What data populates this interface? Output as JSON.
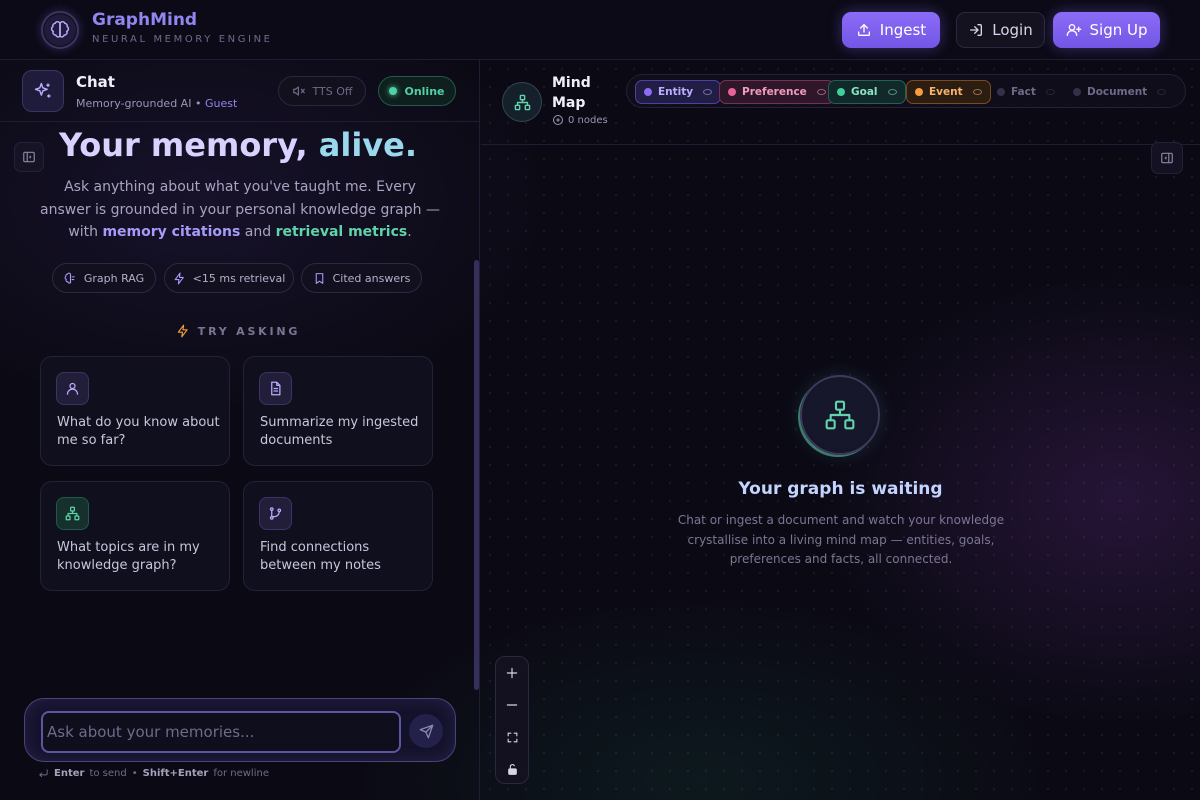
{
  "header": {
    "brand_name": "GraphMind",
    "brand_sub": "NEURAL MEMORY ENGINE",
    "ingest_label": "Ingest",
    "login_label": "Login",
    "signup_label": "Sign Up"
  },
  "chat": {
    "title": "Chat",
    "subtitle": "Memory-grounded AI",
    "separator": "•",
    "user": "Guest",
    "tts_label": "TTS Off",
    "status_label": "Online",
    "hero": {
      "title_main": "Your memory, ",
      "title_highlight": "alive.",
      "text_1": "Ask anything about what you've taught me. Every answer is grounded in your personal knowledge graph — with ",
      "text_link_1": "memory citations",
      "text_2": " and ",
      "text_link_2": "retrieval metrics",
      "text_3": "."
    },
    "chips": [
      {
        "label": "Graph RAG",
        "icon": "brain-icon"
      },
      {
        "label": "<15 ms retrieval",
        "icon": "bolt-icon"
      },
      {
        "label": "Cited answers",
        "icon": "bookmark-icon"
      }
    ],
    "try_label": "TRY ASKING",
    "suggestions": [
      {
        "text": "What do you know about me so far?",
        "icon": "user-icon"
      },
      {
        "text": "Summarize my ingested documents",
        "icon": "document-icon"
      },
      {
        "text": "What topics are in my knowledge graph?",
        "icon": "graph-icon"
      },
      {
        "text": "Find connections between my notes",
        "icon": "branch-icon"
      }
    ],
    "input_placeholder": "Ask about your memories...",
    "input_value": "",
    "hint_key_1": "Enter",
    "hint_text_1": "to send",
    "hint_separator": "•",
    "hint_key_2": "Shift+Enter",
    "hint_text_2": "for newline"
  },
  "mindmap": {
    "title": "Mind Map",
    "nodes_label": "0 nodes",
    "legend": [
      {
        "label": "Entity",
        "color": "#8b6cf6",
        "active": true
      },
      {
        "label": "Preference",
        "color": "#ec5f9b",
        "active": true
      },
      {
        "label": "Goal",
        "color": "#3fcf9a",
        "active": true
      },
      {
        "label": "Event",
        "color": "#f59e3a",
        "active": true
      },
      {
        "label": "Fact",
        "color": "#4a4766",
        "active": false
      },
      {
        "label": "Document",
        "color": "#4a4766",
        "active": false
      }
    ],
    "empty_title": "Your graph is waiting",
    "empty_text": "Chat or ingest a document and watch your knowledge crystallise into a living mind map — entities, goals, preferences and facts, all connected."
  },
  "colors": {
    "accent": "#8b6cf6",
    "online": "#4fd1a5",
    "background": "#0b0a14"
  }
}
